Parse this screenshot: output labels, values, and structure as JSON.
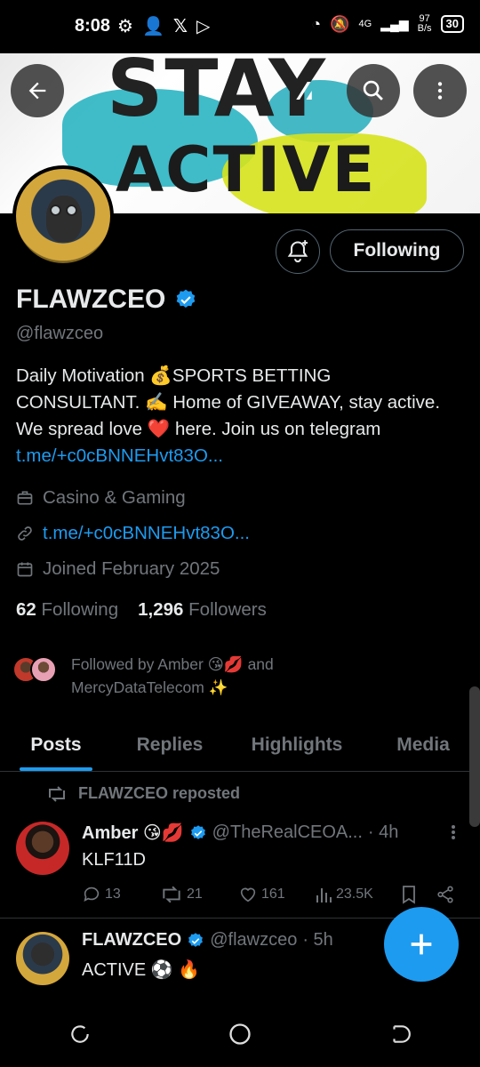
{
  "status_bar": {
    "time": "8:08",
    "network": "4G",
    "speed_value": "97",
    "speed_unit": "B/s",
    "battery": "30"
  },
  "banner": {
    "line1": "STAY",
    "line2": "ACTIVE"
  },
  "profile": {
    "name": "FLAWZCEO",
    "handle": "@flawzceo",
    "follow_label": "Following",
    "bio_text": "Daily Motivation 💰SPORTS BETTING CONSULTANT. ✍️ Home of GIVEAWAY, stay active. We spread love ❤️ here. Join us on telegram ",
    "bio_link": "t.me/+c0cBNNEHvt83O...",
    "category": "Casino & Gaming",
    "website": "t.me/+c0cBNNEHvt83O...",
    "joined": "Joined February 2025",
    "following_count": "62",
    "following_label": "Following",
    "followers_count": "1,296",
    "followers_label": "Followers",
    "followed_by": "Followed by Amber 😘💋 and MercyDataTelecom ✨"
  },
  "tabs": [
    {
      "label": "Posts",
      "active": true
    },
    {
      "label": "Replies",
      "active": false
    },
    {
      "label": "Highlights",
      "active": false
    },
    {
      "label": "Media",
      "active": false
    }
  ],
  "posts": [
    {
      "repost_label": "FLAWZCEO reposted",
      "author": "Amber 😘💋",
      "handle": "@TheRealCEOA...",
      "time": "· 4h",
      "text": "KLF11D",
      "replies": "13",
      "reposts": "21",
      "likes": "161",
      "views": "23.5K"
    },
    {
      "author": "FLAWZCEO",
      "handle": "@flawzceo",
      "time": "· 5h",
      "text": "ACTIVE ⚽ 🔥"
    }
  ],
  "colors": {
    "accent": "#1d9bf0",
    "muted": "#71767b",
    "background": "#000000",
    "text": "#e7e9ea"
  }
}
